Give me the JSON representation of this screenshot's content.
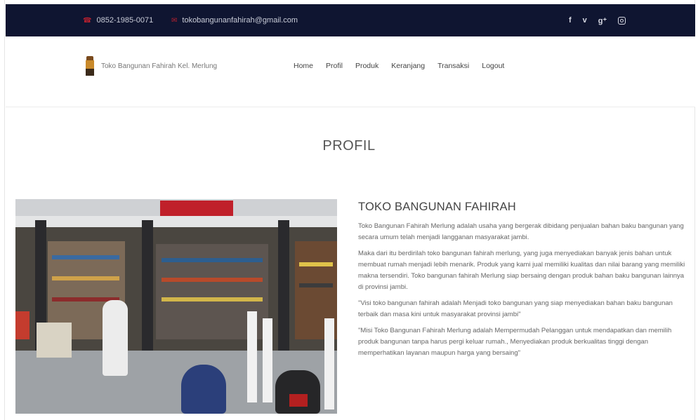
{
  "topbar": {
    "phone": "0852-1985-0071",
    "email": "tokobangunanfahirah@gmail.com",
    "social_icons": [
      "facebook-icon",
      "vimeo-icon",
      "google-plus-icon",
      "instagram-icon"
    ],
    "social_glyphs": {
      "facebook": "f",
      "vimeo": "v",
      "google_plus": "g⁺"
    },
    "background": "#0f1531",
    "accent": "#b8202f"
  },
  "header": {
    "brand_name": "Toko Bangunan Fahirah Kel. Merlung",
    "nav": [
      "Home",
      "Profil",
      "Produk",
      "Keranjang",
      "Transaksi",
      "Logout"
    ]
  },
  "page": {
    "title": "PROFIL"
  },
  "about": {
    "heading": "TOKO BANGUNAN FAHIRAH",
    "paragraphs": [
      "Toko Bangunan Fahirah Merlung adalah usaha yang bergerak dibidang penjualan bahan baku bangunan yang secara umum telah menjadi langganan masyarakat jambi.",
      "Maka dari itu berdirilah toko bangunan fahirah merlung, yang juga menyediakan banyak jenis bahan untuk membuat rumah menjadi lebih menarik. Produk yang kami jual memiliki kualitas dan nilai barang yang memiliki makna tersendiri. Toko bangunan fahirah Merlung siap bersaing dengan produk bahan baku bangunan lainnya di provinsi jambi.",
      "\"Visi toko bangunan fahirah adalah Menjadi toko bangunan yang siap menyediakan bahan baku bangunan terbaik dan masa kini untuk masyarakat provinsi jambi\"",
      "\"Misi Toko Bangunan Fahirah Merlung adalah Mempermudah Pelanggan untuk mendapatkan dan memilih produk bangunan tanpa harus pergi keluar rumah., Menyediakan produk berkualitas tinggi dengan memperhatikan layanan maupun harga yang bersaing\""
    ]
  }
}
